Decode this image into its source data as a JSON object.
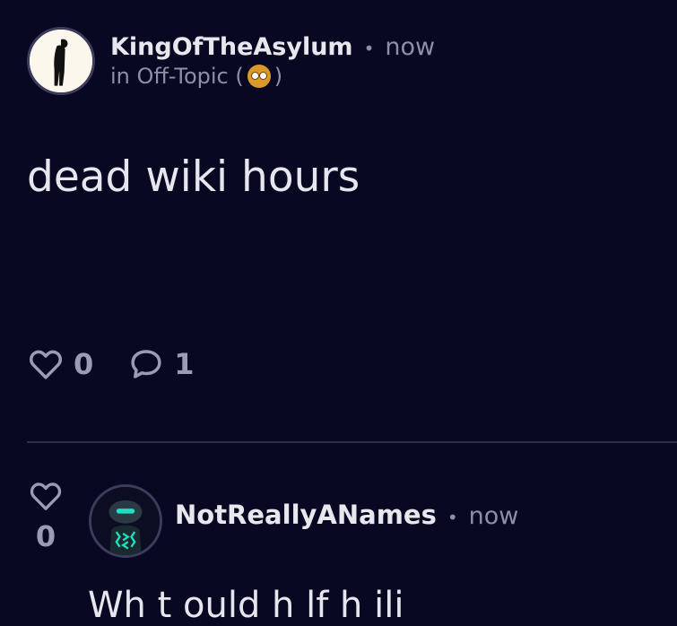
{
  "post": {
    "author": "KingOfTheAsylum",
    "time": "now",
    "category_prefix": "in Off-Topic (",
    "category_suffix": ")",
    "category_emoji": "shocked-face-emoji",
    "body": "dead wiki hours",
    "likes": "0",
    "comments": "1"
  },
  "reply": {
    "author": "NotReallyANames",
    "time": "now",
    "likes": "0",
    "preview": "Wh  t    ould  h  lf  h  ili"
  },
  "colors": {
    "background": "#080823",
    "text": "#e3e3ea",
    "muted": "#8e8fa6",
    "divider": "#2e2f4a"
  }
}
